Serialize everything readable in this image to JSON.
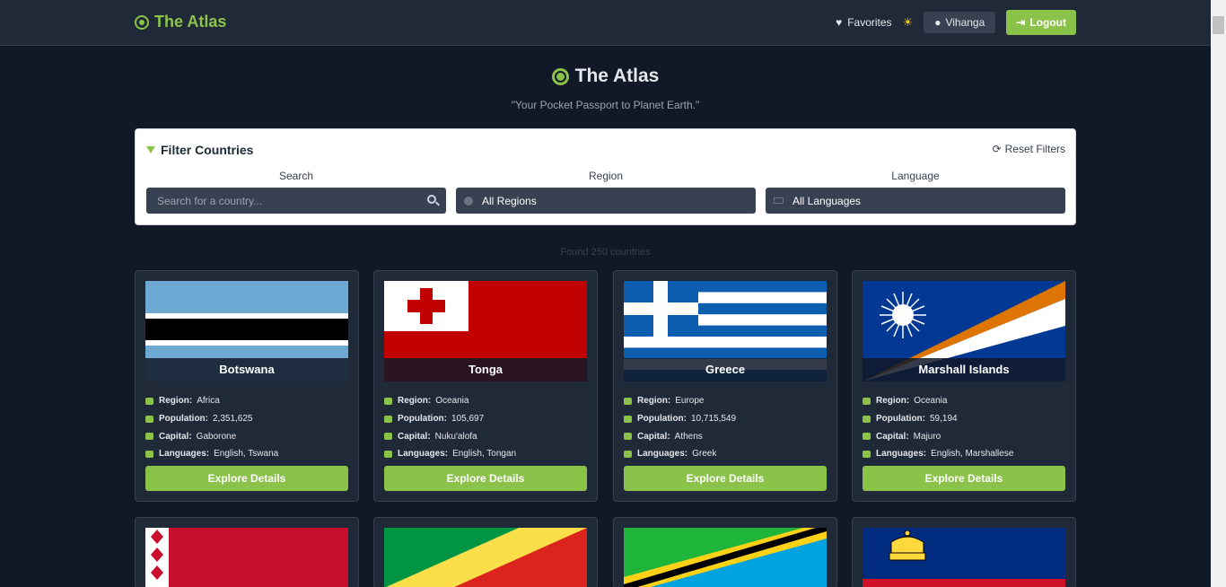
{
  "navbar": {
    "brand": "The Atlas",
    "favorites": "Favorites",
    "user": "Vihanga",
    "logout": "Logout"
  },
  "hero": {
    "title": "The Atlas",
    "tagline": "\"Your Pocket Passport to Planet Earth.\""
  },
  "filters": {
    "title": "Filter Countries",
    "reset": "Reset Filters",
    "search_label": "Search",
    "search_placeholder": "Search for a country...",
    "region_label": "Region",
    "region_value": "All Regions",
    "language_label": "Language",
    "language_value": "All Languages"
  },
  "found_text": "Found 250 countries",
  "labels": {
    "region": "Region:",
    "population": "Population:",
    "capital": "Capital:",
    "languages": "Languages:",
    "explore": "Explore Details"
  },
  "countries": [
    {
      "name": "Botswana",
      "region": "Africa",
      "population": "2,351,625",
      "capital": "Gaborone",
      "languages": "English, Tswana"
    },
    {
      "name": "Tonga",
      "region": "Oceania",
      "population": "105,697",
      "capital": "Nuku'alofa",
      "languages": "English, Tongan"
    },
    {
      "name": "Greece",
      "region": "Europe",
      "population": "10,715,549",
      "capital": "Athens",
      "languages": "Greek"
    },
    {
      "name": "Marshall Islands",
      "region": "Oceania",
      "population": "59,194",
      "capital": "Majuro",
      "languages": "English, Marshallese"
    }
  ],
  "colors": {
    "accent": "#8bc34a",
    "background": "#111827",
    "card": "#1f2937"
  }
}
